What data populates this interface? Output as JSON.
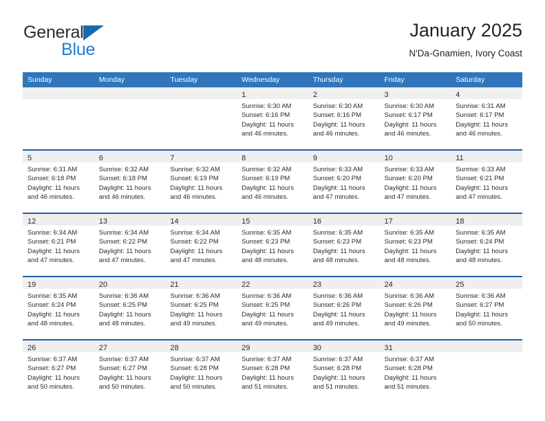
{
  "brand": {
    "name_part1": "General",
    "name_part2": "Blue",
    "triangle_color": "#1769b0",
    "blue_text_color": "#1b7fd4"
  },
  "header": {
    "title": "January 2025",
    "subtitle": "N'Da-Gnamien, Ivory Coast"
  },
  "theme": {
    "header_bg": "#2f76bc",
    "week_separator": "#1f5fa8",
    "daynum_band": "#efefef",
    "text": "#2b2b2b"
  },
  "calendar": {
    "weekday_headers": [
      "Sunday",
      "Monday",
      "Tuesday",
      "Wednesday",
      "Thursday",
      "Friday",
      "Saturday"
    ],
    "weeks": [
      [
        {
          "day": "",
          "sunrise": "",
          "sunset": "",
          "daylight1": "",
          "daylight2": ""
        },
        {
          "day": "",
          "sunrise": "",
          "sunset": "",
          "daylight1": "",
          "daylight2": ""
        },
        {
          "day": "",
          "sunrise": "",
          "sunset": "",
          "daylight1": "",
          "daylight2": ""
        },
        {
          "day": "1",
          "sunrise": "Sunrise: 6:30 AM",
          "sunset": "Sunset: 6:16 PM",
          "daylight1": "Daylight: 11 hours",
          "daylight2": "and 46 minutes."
        },
        {
          "day": "2",
          "sunrise": "Sunrise: 6:30 AM",
          "sunset": "Sunset: 6:16 PM",
          "daylight1": "Daylight: 11 hours",
          "daylight2": "and 46 minutes."
        },
        {
          "day": "3",
          "sunrise": "Sunrise: 6:30 AM",
          "sunset": "Sunset: 6:17 PM",
          "daylight1": "Daylight: 11 hours",
          "daylight2": "and 46 minutes."
        },
        {
          "day": "4",
          "sunrise": "Sunrise: 6:31 AM",
          "sunset": "Sunset: 6:17 PM",
          "daylight1": "Daylight: 11 hours",
          "daylight2": "and 46 minutes."
        }
      ],
      [
        {
          "day": "5",
          "sunrise": "Sunrise: 6:31 AM",
          "sunset": "Sunset: 6:18 PM",
          "daylight1": "Daylight: 11 hours",
          "daylight2": "and 46 minutes."
        },
        {
          "day": "6",
          "sunrise": "Sunrise: 6:32 AM",
          "sunset": "Sunset: 6:18 PM",
          "daylight1": "Daylight: 11 hours",
          "daylight2": "and 46 minutes."
        },
        {
          "day": "7",
          "sunrise": "Sunrise: 6:32 AM",
          "sunset": "Sunset: 6:19 PM",
          "daylight1": "Daylight: 11 hours",
          "daylight2": "and 46 minutes."
        },
        {
          "day": "8",
          "sunrise": "Sunrise: 6:32 AM",
          "sunset": "Sunset: 6:19 PM",
          "daylight1": "Daylight: 11 hours",
          "daylight2": "and 46 minutes."
        },
        {
          "day": "9",
          "sunrise": "Sunrise: 6:33 AM",
          "sunset": "Sunset: 6:20 PM",
          "daylight1": "Daylight: 11 hours",
          "daylight2": "and 47 minutes."
        },
        {
          "day": "10",
          "sunrise": "Sunrise: 6:33 AM",
          "sunset": "Sunset: 6:20 PM",
          "daylight1": "Daylight: 11 hours",
          "daylight2": "and 47 minutes."
        },
        {
          "day": "11",
          "sunrise": "Sunrise: 6:33 AM",
          "sunset": "Sunset: 6:21 PM",
          "daylight1": "Daylight: 11 hours",
          "daylight2": "and 47 minutes."
        }
      ],
      [
        {
          "day": "12",
          "sunrise": "Sunrise: 6:34 AM",
          "sunset": "Sunset: 6:21 PM",
          "daylight1": "Daylight: 11 hours",
          "daylight2": "and 47 minutes."
        },
        {
          "day": "13",
          "sunrise": "Sunrise: 6:34 AM",
          "sunset": "Sunset: 6:22 PM",
          "daylight1": "Daylight: 11 hours",
          "daylight2": "and 47 minutes."
        },
        {
          "day": "14",
          "sunrise": "Sunrise: 6:34 AM",
          "sunset": "Sunset: 6:22 PM",
          "daylight1": "Daylight: 11 hours",
          "daylight2": "and 47 minutes."
        },
        {
          "day": "15",
          "sunrise": "Sunrise: 6:35 AM",
          "sunset": "Sunset: 6:23 PM",
          "daylight1": "Daylight: 11 hours",
          "daylight2": "and 48 minutes."
        },
        {
          "day": "16",
          "sunrise": "Sunrise: 6:35 AM",
          "sunset": "Sunset: 6:23 PM",
          "daylight1": "Daylight: 11 hours",
          "daylight2": "and 48 minutes."
        },
        {
          "day": "17",
          "sunrise": "Sunrise: 6:35 AM",
          "sunset": "Sunset: 6:23 PM",
          "daylight1": "Daylight: 11 hours",
          "daylight2": "and 48 minutes."
        },
        {
          "day": "18",
          "sunrise": "Sunrise: 6:35 AM",
          "sunset": "Sunset: 6:24 PM",
          "daylight1": "Daylight: 11 hours",
          "daylight2": "and 48 minutes."
        }
      ],
      [
        {
          "day": "19",
          "sunrise": "Sunrise: 6:35 AM",
          "sunset": "Sunset: 6:24 PM",
          "daylight1": "Daylight: 11 hours",
          "daylight2": "and 48 minutes."
        },
        {
          "day": "20",
          "sunrise": "Sunrise: 6:36 AM",
          "sunset": "Sunset: 6:25 PM",
          "daylight1": "Daylight: 11 hours",
          "daylight2": "and 48 minutes."
        },
        {
          "day": "21",
          "sunrise": "Sunrise: 6:36 AM",
          "sunset": "Sunset: 6:25 PM",
          "daylight1": "Daylight: 11 hours",
          "daylight2": "and 49 minutes."
        },
        {
          "day": "22",
          "sunrise": "Sunrise: 6:36 AM",
          "sunset": "Sunset: 6:25 PM",
          "daylight1": "Daylight: 11 hours",
          "daylight2": "and 49 minutes."
        },
        {
          "day": "23",
          "sunrise": "Sunrise: 6:36 AM",
          "sunset": "Sunset: 6:26 PM",
          "daylight1": "Daylight: 11 hours",
          "daylight2": "and 49 minutes."
        },
        {
          "day": "24",
          "sunrise": "Sunrise: 6:36 AM",
          "sunset": "Sunset: 6:26 PM",
          "daylight1": "Daylight: 11 hours",
          "daylight2": "and 49 minutes."
        },
        {
          "day": "25",
          "sunrise": "Sunrise: 6:36 AM",
          "sunset": "Sunset: 6:27 PM",
          "daylight1": "Daylight: 11 hours",
          "daylight2": "and 50 minutes."
        }
      ],
      [
        {
          "day": "26",
          "sunrise": "Sunrise: 6:37 AM",
          "sunset": "Sunset: 6:27 PM",
          "daylight1": "Daylight: 11 hours",
          "daylight2": "and 50 minutes."
        },
        {
          "day": "27",
          "sunrise": "Sunrise: 6:37 AM",
          "sunset": "Sunset: 6:27 PM",
          "daylight1": "Daylight: 11 hours",
          "daylight2": "and 50 minutes."
        },
        {
          "day": "28",
          "sunrise": "Sunrise: 6:37 AM",
          "sunset": "Sunset: 6:28 PM",
          "daylight1": "Daylight: 11 hours",
          "daylight2": "and 50 minutes."
        },
        {
          "day": "29",
          "sunrise": "Sunrise: 6:37 AM",
          "sunset": "Sunset: 6:28 PM",
          "daylight1": "Daylight: 11 hours",
          "daylight2": "and 51 minutes."
        },
        {
          "day": "30",
          "sunrise": "Sunrise: 6:37 AM",
          "sunset": "Sunset: 6:28 PM",
          "daylight1": "Daylight: 11 hours",
          "daylight2": "and 51 minutes."
        },
        {
          "day": "31",
          "sunrise": "Sunrise: 6:37 AM",
          "sunset": "Sunset: 6:28 PM",
          "daylight1": "Daylight: 11 hours",
          "daylight2": "and 51 minutes."
        },
        {
          "day": "",
          "sunrise": "",
          "sunset": "",
          "daylight1": "",
          "daylight2": ""
        }
      ]
    ]
  }
}
